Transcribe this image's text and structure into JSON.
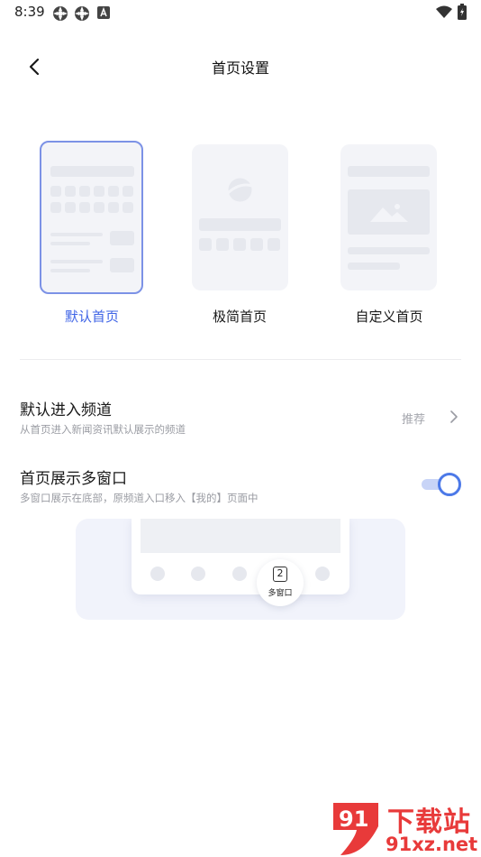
{
  "status_bar": {
    "time": "8:39"
  },
  "header": {
    "title": "首页设置"
  },
  "home_options": [
    {
      "label": "默认首页",
      "selected": true
    },
    {
      "label": "极简首页",
      "selected": false
    },
    {
      "label": "自定义首页",
      "selected": false
    }
  ],
  "settings": {
    "default_channel": {
      "title": "默认进入频道",
      "description": "从首页进入新闻资讯默认展示的频道",
      "value": "推荐"
    },
    "multi_window": {
      "title": "首页展示多窗口",
      "description": "多窗口展示在底部，原频道入口移入【我的】页面中",
      "enabled": true
    }
  },
  "preview": {
    "badge": "2",
    "label": "多窗口"
  },
  "watermark": {
    "brand": "下载站",
    "site": "91xz.net",
    "logo_text": "91"
  },
  "colors": {
    "accent": "#3f64e6",
    "selected_border": "#7c92e6",
    "toggle": "#4c79e8",
    "watermark": "#e83a3a"
  }
}
